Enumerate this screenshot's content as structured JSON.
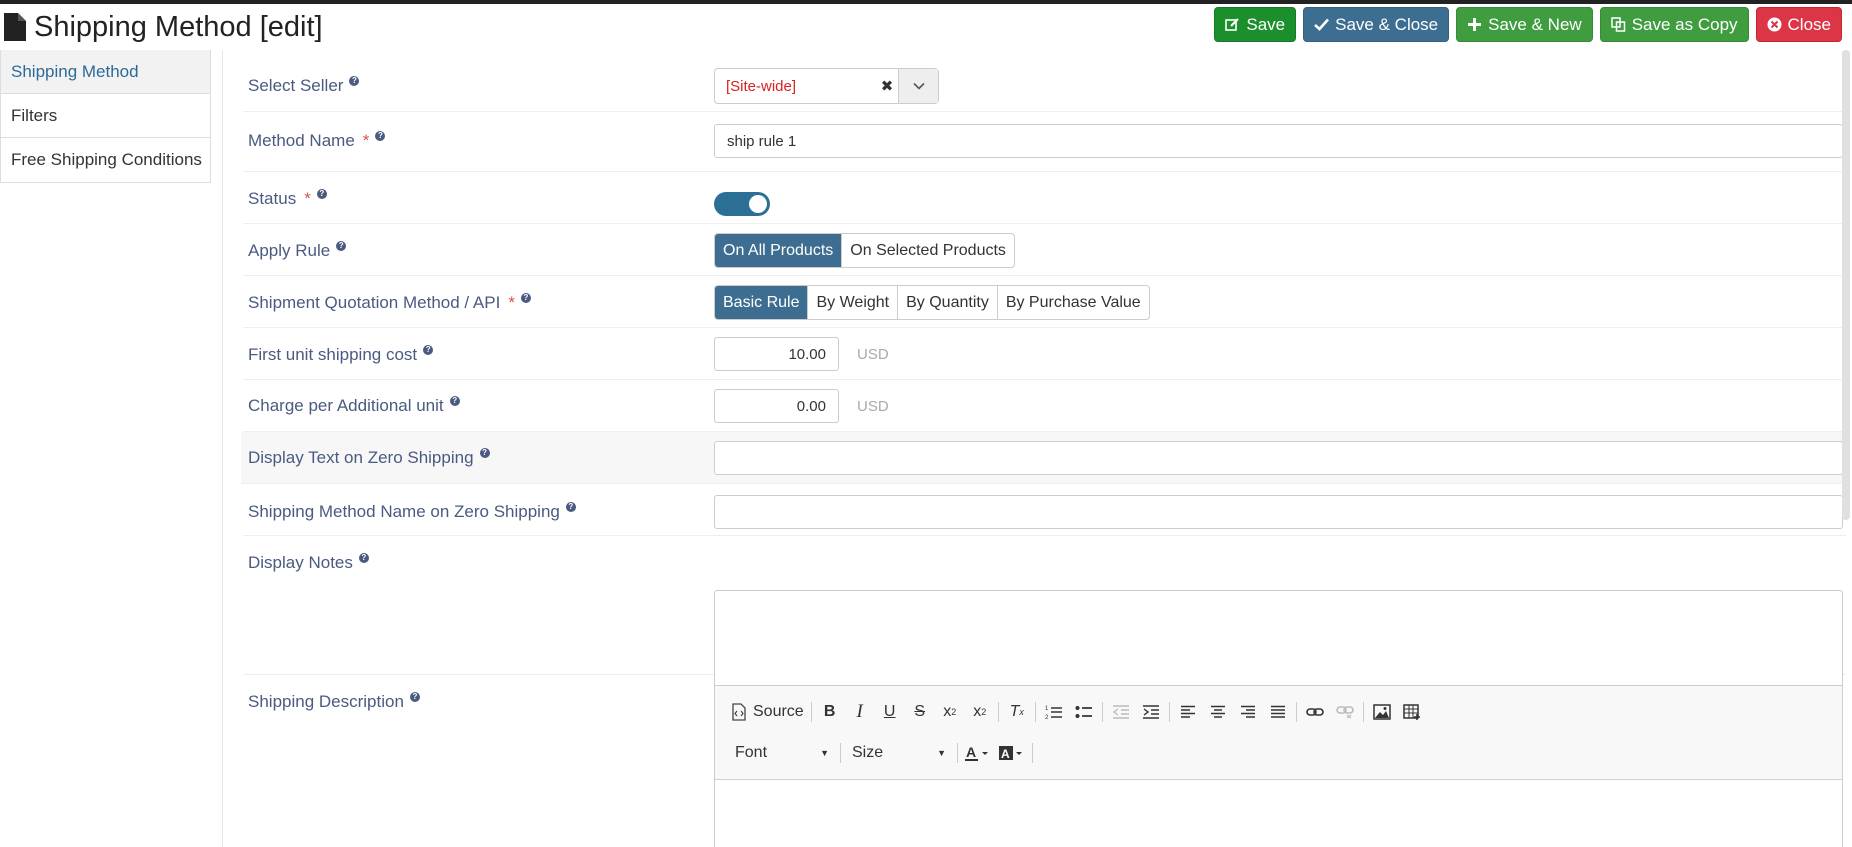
{
  "header": {
    "title": "Shipping Method [edit]",
    "buttons": {
      "save": "Save",
      "save_close": "Save & Close",
      "save_new": "Save & New",
      "save_copy": "Save as Copy",
      "close": "Close"
    }
  },
  "sidebar": {
    "items": [
      {
        "label": "Shipping Method",
        "active": true
      },
      {
        "label": "Filters"
      },
      {
        "label": "Free Shipping Conditions"
      }
    ]
  },
  "form": {
    "seller": {
      "label": "Select Seller",
      "value": "[Site-wide]"
    },
    "method_name": {
      "label": "Method Name",
      "required": "*",
      "value": "ship rule 1"
    },
    "status": {
      "label": "Status",
      "required": "*",
      "enabled": true
    },
    "apply_rule": {
      "label": "Apply Rule",
      "options": [
        "On All Products",
        "On Selected Products"
      ],
      "selected": "On All Products"
    },
    "quotation": {
      "label": "Shipment Quotation Method / API",
      "required": "*",
      "options": [
        "Basic Rule",
        "By Weight",
        "By Quantity",
        "By Purchase Value"
      ],
      "selected": "Basic Rule"
    },
    "first_unit": {
      "label": "First unit shipping cost",
      "value": "10.00",
      "unit": "USD"
    },
    "additional_unit": {
      "label": "Charge per Additional unit",
      "value": "0.00",
      "unit": "USD"
    },
    "zero_text": {
      "label": "Display Text on Zero Shipping",
      "value": ""
    },
    "zero_name": {
      "label": "Shipping Method Name on Zero Shipping",
      "value": ""
    },
    "notes": {
      "label": "Display Notes",
      "value": ""
    },
    "description": {
      "label": "Shipping Description",
      "toolbar": {
        "source": "Source",
        "font": "Font",
        "size": "Size"
      }
    }
  },
  "colors": {
    "primary": "#3d6e91",
    "success": "#1b8f2b",
    "danger": "#dc3545",
    "label": "#4a5a80"
  }
}
